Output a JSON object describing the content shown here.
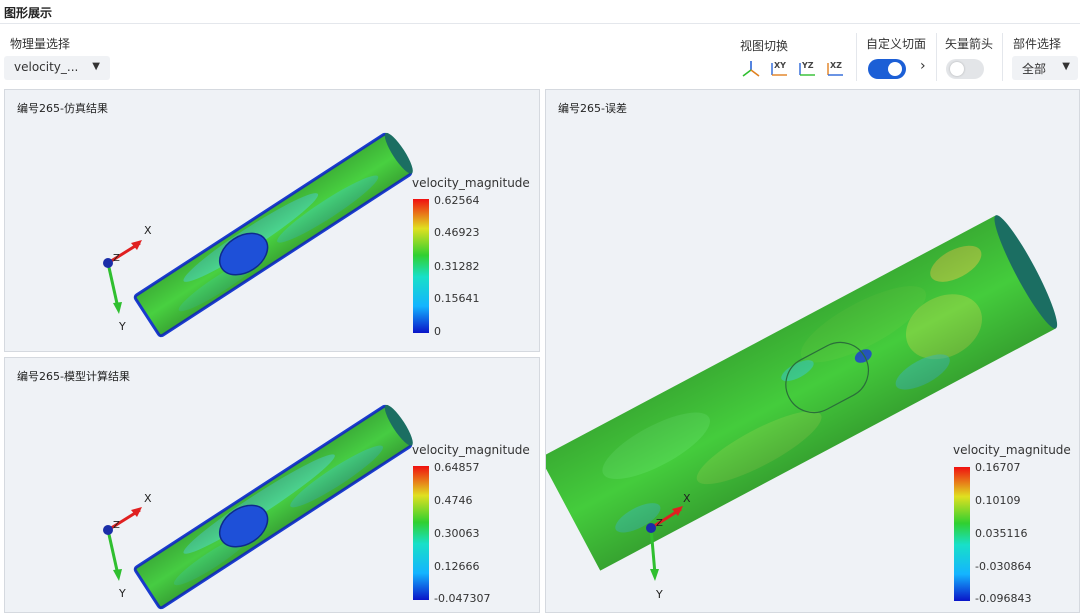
{
  "app": {
    "title": "图形展示"
  },
  "controls": {
    "physical_quantity_label": "物理量选择",
    "physical_quantity_value": "velocity_...",
    "view_switch_label": "视图切换",
    "view_buttons": [
      {
        "label": "",
        "icon": "iso-axes-icon"
      },
      {
        "label": "XY",
        "icon": "xy-view-icon"
      },
      {
        "label": "YZ",
        "icon": "yz-view-icon"
      },
      {
        "label": "XZ",
        "icon": "xz-view-icon"
      }
    ],
    "custom_section_label": "自定义切面",
    "custom_section_on": true,
    "expand_arrow": "›",
    "vector_arrow_label": "矢量箭头",
    "vector_arrow_on": false,
    "part_select_label": "部件选择",
    "part_select_value": "全部",
    "dropdown_caret": "▼"
  },
  "panels": {
    "sim": {
      "title": "编号265-仿真结果",
      "colorbar": {
        "title": "velocity_magnitude",
        "ticks": [
          "0.62564",
          "0.46923",
          "0.31282",
          "0.15641",
          "0"
        ]
      },
      "axes": {
        "x": "X",
        "y": "Y",
        "z": "Z"
      }
    },
    "model": {
      "title": "编号265-模型计算结果",
      "colorbar": {
        "title": "velocity_magnitude",
        "ticks": [
          "0.64857",
          "0.4746",
          "0.30063",
          "0.12666",
          "-0.047307"
        ]
      },
      "axes": {
        "x": "X",
        "y": "Y",
        "z": "Z"
      }
    },
    "error": {
      "title": "编号265-误差",
      "colorbar": {
        "title": "velocity_magnitude",
        "ticks": [
          "0.16707",
          "0.10109",
          "0.035116",
          "-0.030864",
          "-0.096843"
        ]
      },
      "axes": {
        "x": "X",
        "y": "Y",
        "z": "Z"
      }
    }
  },
  "colors": {
    "accent": "#1c5fd6",
    "toggle_off": "#e3e5e8",
    "panel_bg": "#eff2f6",
    "field_green": "#3fcf3a",
    "cylinder_cap": "#1b6e62",
    "axis_x": "#e02020",
    "axis_y": "#2fbf2f",
    "axis_z": "#1a2ea8"
  }
}
